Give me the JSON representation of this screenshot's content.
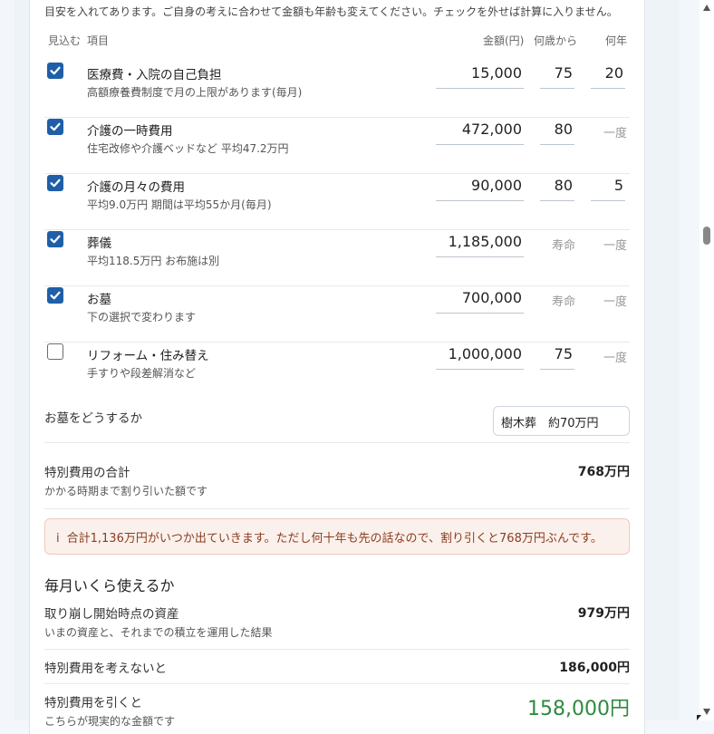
{
  "intro": "目安を入れてあります。ご自身の考えに合わせて金額も年齢も変えてください。チェックを外せば計算に入りません。",
  "headers": {
    "include": "見込む",
    "item": "項目",
    "amount": "金額(円)",
    "from_age": "何歳から",
    "years": "何年"
  },
  "rows": [
    {
      "checked": true,
      "name": "医療費・入院の自己負担",
      "desc": "高額療養費制度で月の上限があります(毎月)",
      "amount": "15,000",
      "age": "75",
      "years": "20"
    },
    {
      "checked": true,
      "name": "介護の一時費用",
      "desc": "住宅改修や介護ベッドなど 平均47.2万円",
      "amount": "472,000",
      "age": "80",
      "years_text": "一度"
    },
    {
      "checked": true,
      "name": "介護の月々の費用",
      "desc": "平均9.0万円 期間は平均55か月(毎月)",
      "amount": "90,000",
      "age": "80",
      "years": "5"
    },
    {
      "checked": true,
      "name": "葬儀",
      "desc": "平均118.5万円 お布施は別",
      "amount": "1,185,000",
      "age_text": "寿命",
      "years_text": "一度"
    },
    {
      "checked": true,
      "name": "お墓",
      "desc": "下の選択で変わります",
      "amount": "700,000",
      "age_text": "寿命",
      "years_text": "一度"
    },
    {
      "checked": false,
      "name": "リフォーム・住み替え",
      "desc": "手すりや段差解消など",
      "amount": "1,000,000",
      "age": "75",
      "years_text": "一度"
    }
  ],
  "grave": {
    "label": "お墓をどうするか",
    "selected": "樹木葬　約70万円"
  },
  "special_total": {
    "label": "特別費用の合計",
    "sub": "かかる時期まで割り引いた額です",
    "value": "768万円"
  },
  "notice": {
    "icon": "i",
    "text": "合計1,136万円がいつか出ていきます。ただし何十年も先の話なので、割り引くと768万円ぶんです。"
  },
  "monthly": {
    "title": "毎月いくら使えるか",
    "assets": {
      "label": "取り崩し開始時点の資産",
      "sub": "いまの資産と、それまでの積立を運用した結果",
      "value": "979万円"
    },
    "without": {
      "label": "特別費用を考えないと",
      "value": "186,000円"
    },
    "with": {
      "label": "特別費用を引くと",
      "sub": "こちらが現実的な金額です",
      "value": "158,000円"
    }
  },
  "colors": {
    "check": "#1f5fa8",
    "green": "#2f8a3e",
    "notice_bg": "#fbf1ec",
    "notice_text": "#8a3d1f"
  }
}
